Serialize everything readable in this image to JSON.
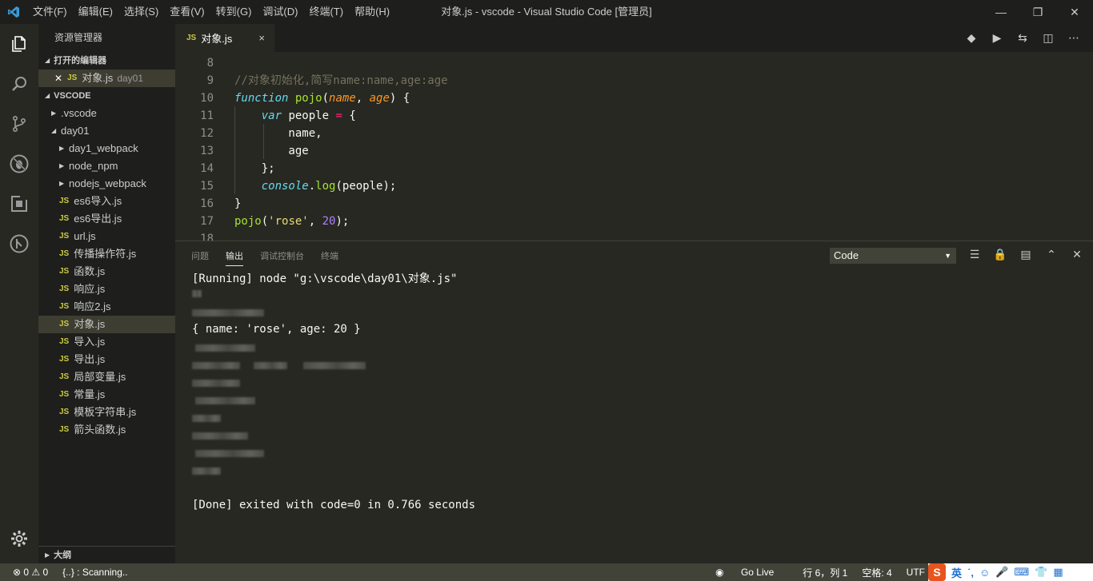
{
  "titlebar": {
    "menu": [
      "文件(F)",
      "编辑(E)",
      "选择(S)",
      "查看(V)",
      "转到(G)",
      "调试(D)",
      "终端(T)",
      "帮助(H)"
    ],
    "title": "对象.js - vscode - Visual Studio Code [管理员]"
  },
  "sidebar": {
    "title": "资源管理器",
    "open_editors_label": "打开的编辑器",
    "open_file": {
      "name": "对象.js",
      "folder": "day01"
    },
    "workspace_label": "VSCODE",
    "tree": [
      {
        "name": ".vscode",
        "type": "folder"
      },
      {
        "name": "day01",
        "type": "folder-open"
      },
      {
        "name": "day1_webpack",
        "type": "subfolder"
      },
      {
        "name": "node_npm",
        "type": "subfolder"
      },
      {
        "name": "nodejs_webpack",
        "type": "subfolder"
      },
      {
        "name": "es6导入.js",
        "type": "js"
      },
      {
        "name": "es6导出.js",
        "type": "js"
      },
      {
        "name": "url.js",
        "type": "js"
      },
      {
        "name": "传播操作符.js",
        "type": "js"
      },
      {
        "name": "函数.js",
        "type": "js"
      },
      {
        "name": "响应.js",
        "type": "js"
      },
      {
        "name": "响应2.js",
        "type": "js"
      },
      {
        "name": "对象.js",
        "type": "js",
        "active": true
      },
      {
        "name": "导入.js",
        "type": "js"
      },
      {
        "name": "导出.js",
        "type": "js"
      },
      {
        "name": "局部变量.js",
        "type": "js"
      },
      {
        "name": "常量.js",
        "type": "js"
      },
      {
        "name": "模板字符串.js",
        "type": "js"
      },
      {
        "name": "箭头函数.js",
        "type": "js"
      }
    ],
    "outline_label": "大纲",
    "js_badge": "JS"
  },
  "tab": {
    "name": "对象.js",
    "close": "×"
  },
  "editor": {
    "line_numbers": [
      "8",
      "9",
      "10",
      "11",
      "12",
      "13",
      "14",
      "15",
      "16",
      "17",
      "18"
    ]
  },
  "panel": {
    "tabs": [
      "问题",
      "输出",
      "调试控制台",
      "终端"
    ],
    "active_tab": "输出",
    "channel": "Code",
    "output": {
      "running": "[Running] node \"g:\\vscode\\day01\\对象.js\"",
      "result": "{ name: 'rose', age: 20 }",
      "done": "[Done] exited with code=0 in 0.766 seconds"
    }
  },
  "statusbar": {
    "problems": "⊗ 0 ⚠ 0",
    "scanning": "{..} : Scanning..",
    "golive": "Go Live",
    "position": "行 6，列 1",
    "spaces": "空格: 4",
    "encoding": "UTF"
  },
  "ime": {
    "lang": "英"
  }
}
